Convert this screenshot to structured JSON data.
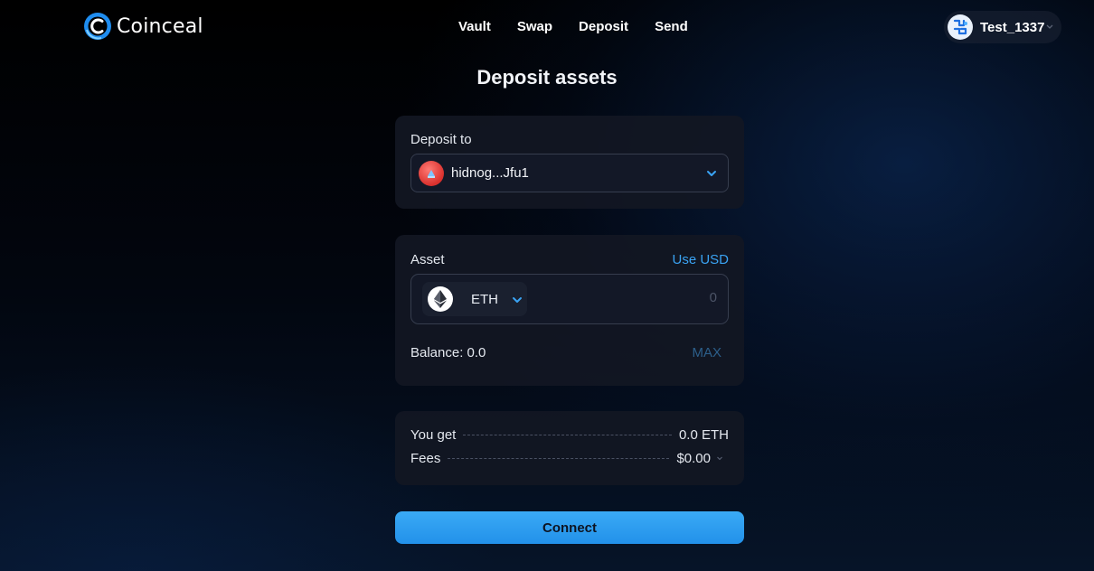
{
  "brand": {
    "name": "Coinceal"
  },
  "nav": {
    "items": [
      "Vault",
      "Swap",
      "Deposit",
      "Send"
    ]
  },
  "user": {
    "name": "Test_1337"
  },
  "page": {
    "title": "Deposit assets"
  },
  "deposit_to": {
    "label": "Deposit to",
    "account": "hidnog...Jfu1"
  },
  "asset": {
    "label": "Asset",
    "use_usd": "Use USD",
    "symbol": "ETH",
    "amount_placeholder": "0",
    "balance": "Balance: 0.0",
    "max": "MAX"
  },
  "summary": {
    "you_get_label": "You get",
    "you_get_value": "0.0 ETH",
    "fees_label": "Fees",
    "fees_value": "$0.00"
  },
  "actions": {
    "connect": "Connect"
  },
  "colors": {
    "accent": "#3aa3f3",
    "button": "#2a9bef",
    "card": "#121723"
  },
  "icons": {
    "logo": "coinceal-logo-icon",
    "avatar": "user-avatar-icon",
    "account": "account-icon",
    "eth": "ethereum-icon",
    "chevron": "chevron-down-icon"
  }
}
